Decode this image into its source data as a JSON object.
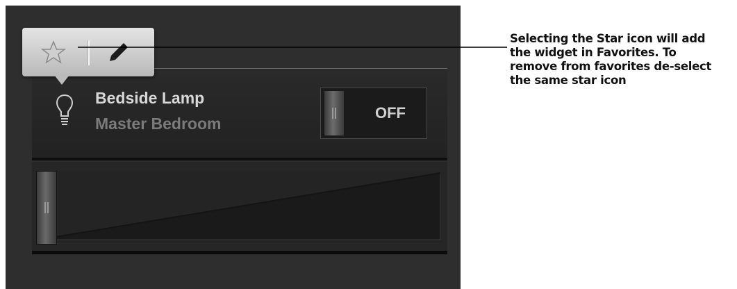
{
  "widget": {
    "device_name": "Bedside Lamp",
    "room_name": "Master Bedroom",
    "toggle_state": "OFF",
    "dimmer_level": 0
  },
  "toolbar": {
    "icons": [
      "star-icon",
      "pencil-icon"
    ]
  },
  "annotation": {
    "lines": [
      "Selecting the Star icon will add",
      "the widget in Favorites. To",
      "remove from favorites de-select",
      "the same star icon"
    ]
  },
  "colors": {
    "panel_bg": "#2e2e2e",
    "text_primary": "#d8d8d8",
    "text_secondary": "#7b7b7b",
    "toolbar_bg": "#d4d4d4"
  }
}
